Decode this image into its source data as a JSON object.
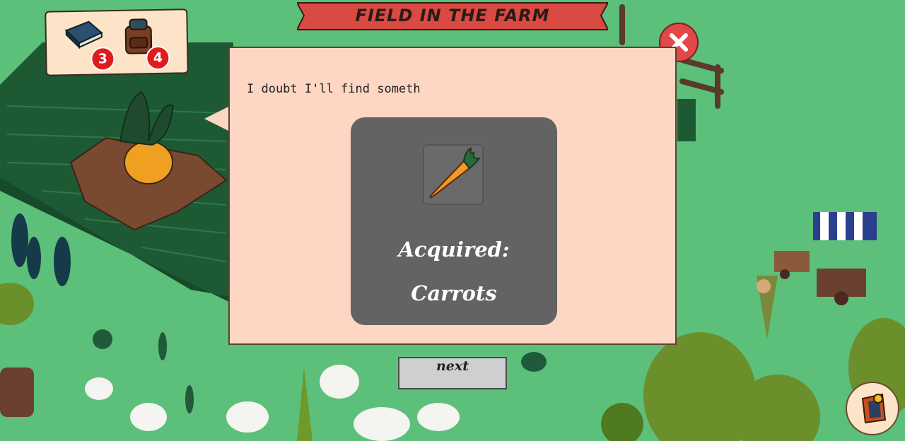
{
  "header": {
    "title": "FIELD IN THE FARM"
  },
  "inventory": {
    "items": [
      {
        "name": "book",
        "icon": "book-icon",
        "count": "3"
      },
      {
        "name": "bag",
        "icon": "backpack-icon",
        "count": "4"
      }
    ]
  },
  "dialog": {
    "text": "I doubt I'll find someth",
    "reward": {
      "title": "Acquired:",
      "item": "Carrots",
      "icon": "carrot-icon"
    },
    "next_label": "next"
  },
  "close": {
    "icon": "close-icon"
  },
  "menu": {
    "icon": "character-menu-icon"
  },
  "colors": {
    "grass": "#5cbf7a",
    "dialog_bg": "#fdd7c3",
    "reward_card": "#636363",
    "close_red": "#e14848",
    "badge_red": "#e01b1b",
    "banner_red": "#d94a43"
  }
}
